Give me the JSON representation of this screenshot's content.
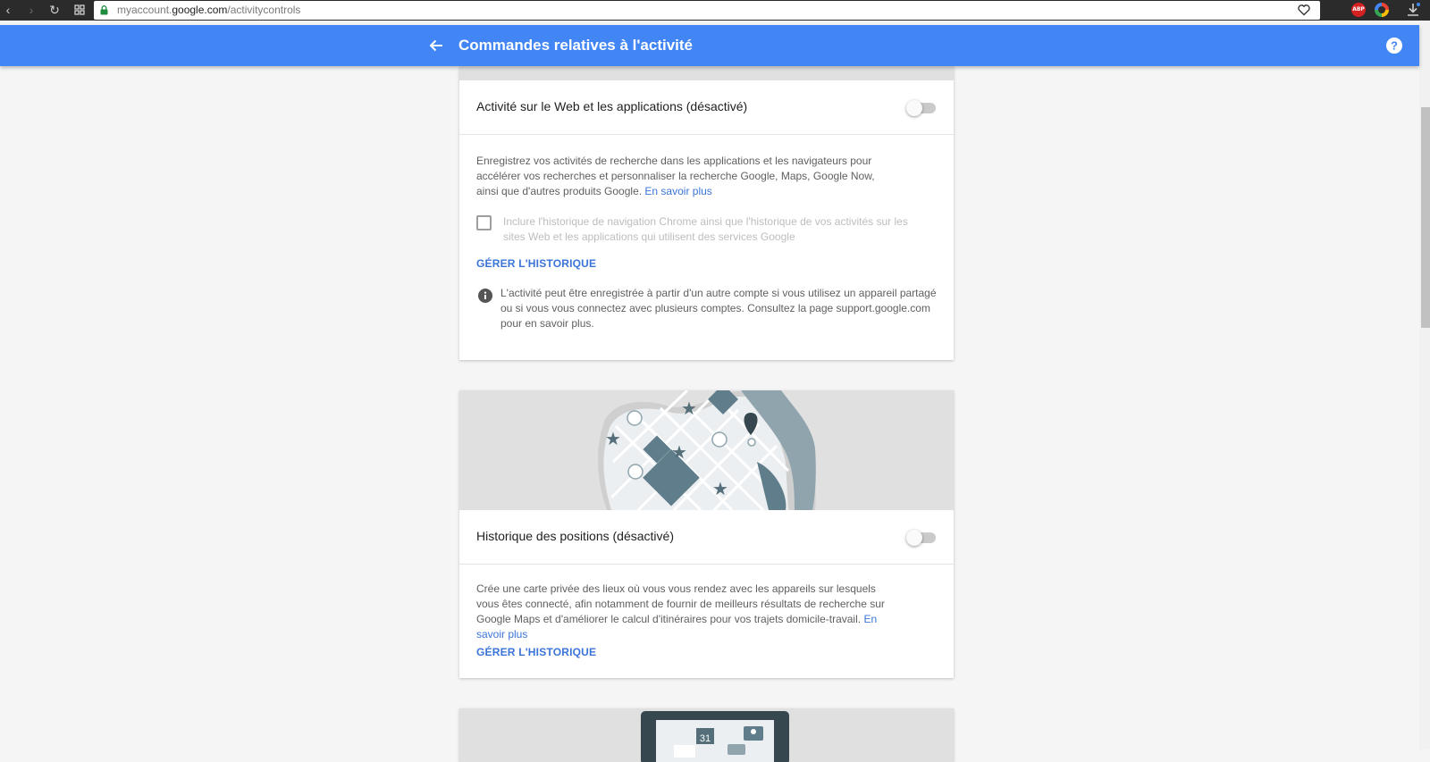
{
  "browser": {
    "url_prefix": "myaccount.",
    "url_domain": "google.com",
    "url_path": "/activitycontrols",
    "extension_abp": "ABP"
  },
  "header": {
    "title": "Commandes relatives à l'activité",
    "color": "#4285f4"
  },
  "web_activity": {
    "title": "Activité sur le Web et les applications (désactivé)",
    "enabled": false,
    "description": "Enregistrez vos activités de recherche dans les applications et les navigateurs pour accélérer vos recherches et personnaliser la recherche Google, Maps, Google Now, ainsi que d'autres produits Google.",
    "learn_more": "En savoir plus",
    "checkbox_label": "Inclure l'historique de navigation Chrome ainsi que l'historique de vos activités sur les sites Web et les applications qui utilisent des services Google",
    "checkbox_checked": false,
    "manage_label": "GÉRER L'HISTORIQUE",
    "info_text": "L'activité peut être enregistrée à partir d'un autre compte si vous utilisez un appareil partagé ou si vous vous connectez avec plusieurs comptes. Consultez la page support.google.com pour en savoir plus."
  },
  "location_history": {
    "title": "Historique des positions (désactivé)",
    "enabled": false,
    "description": "Crée une carte privée des lieux où vous vous rendez avec les appareils sur lesquels vous êtes connecté, afin notamment de fournir de meilleurs résultats de recherche sur Google Maps et d'améliorer le calcul d'itinéraires pour vos trajets domicile-travail.",
    "learn_more": "En savoir plus",
    "manage_label": "GÉRER L'HISTORIQUE"
  },
  "device_info": {
    "calendar_day": "31"
  },
  "colors": {
    "link": "#3b74d8",
    "illustration_bg": "#e0e0e0"
  }
}
